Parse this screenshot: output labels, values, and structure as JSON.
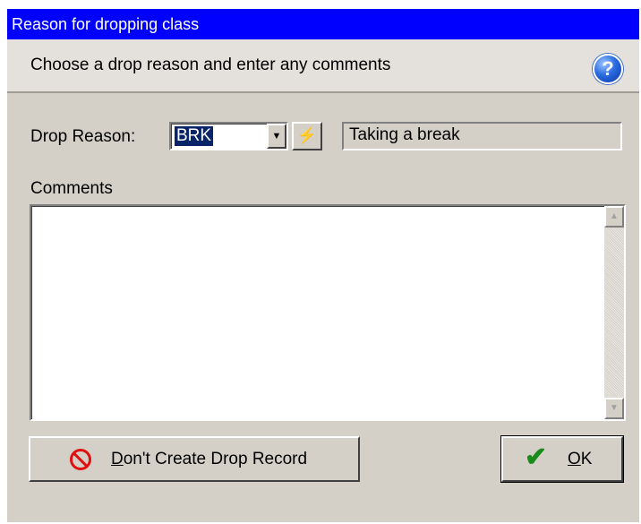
{
  "window": {
    "title": "Reason for dropping class"
  },
  "header": {
    "text": "Choose a drop reason and enter any comments",
    "help_icon": "help-icon"
  },
  "drop_reason": {
    "label": "Drop Reason:",
    "code": "BRK",
    "description": "Taking a break"
  },
  "comments": {
    "label": "Comments",
    "value": ""
  },
  "buttons": {
    "dont_create_prefix": "D",
    "dont_create_rest": "on't Create Drop Record",
    "ok_prefix": "O",
    "ok_rest": "K"
  },
  "colors": {
    "titlebar": "#0000ff",
    "selection": "#0a246a",
    "no_icon": "#e01010",
    "check_icon": "#1a8a1a"
  }
}
